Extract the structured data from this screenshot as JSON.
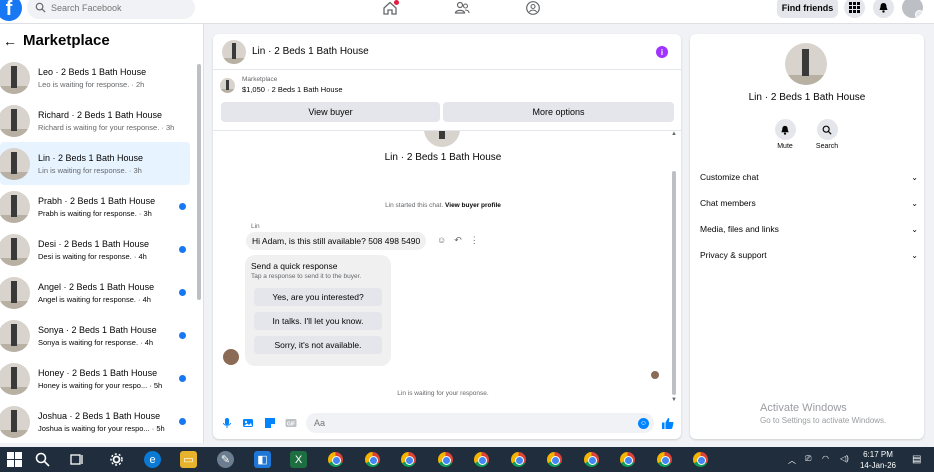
{
  "topbar": {
    "search_placeholder": "Search Facebook",
    "find_friends_label": "Find friends"
  },
  "left": {
    "back_arrow": "←",
    "title": "Marketplace",
    "threads": [
      {
        "title": "Leo · 2 Beds 1 Bath House",
        "sub": "Leo is waiting for response. · 2h",
        "unread": false,
        "active": false
      },
      {
        "title": "Richard · 2 Beds 1 Bath House",
        "sub": "Richard is waiting for your response. · 3h",
        "unread": false,
        "active": false
      },
      {
        "title": "Lin · 2 Beds 1 Bath House",
        "sub": "Lin is waiting for response. · 3h",
        "unread": false,
        "active": true
      },
      {
        "title": "Prabh · 2 Beds 1 Bath House",
        "sub": "Prabh is waiting for response. · 3h",
        "unread": true,
        "active": false
      },
      {
        "title": "Desi · 2 Beds 1 Bath House",
        "sub": "Desi is waiting for response. · 4h",
        "unread": true,
        "active": false
      },
      {
        "title": "Angel · 2 Beds 1 Bath House",
        "sub": "Angel is waiting for response. · 4h",
        "unread": true,
        "active": false
      },
      {
        "title": "Sonya · 2 Beds 1 Bath House",
        "sub": "Sonya is waiting for response. · 4h",
        "unread": true,
        "active": false
      },
      {
        "title": "Honey · 2 Beds 1 Bath House",
        "sub": "Honey is waiting for your respo... · 5h",
        "unread": true,
        "active": false
      },
      {
        "title": "Joshua · 2 Beds 1 Bath House",
        "sub": "Joshua is waiting for your respo... · 5h",
        "unread": true,
        "active": false
      }
    ]
  },
  "chat": {
    "header_title": "Lin · 2 Beds 1 Bath House",
    "listing_label": "Marketplace",
    "listing_price": "$1,050 · 2 Beds 1 Bath House",
    "view_buyer_label": "View buyer",
    "more_options_label": "More options",
    "conv_title": "Lin · 2 Beds 1 Bath House",
    "started_text": "Lin started this chat.",
    "view_profile_link": "View buyer profile",
    "sender_name": "Lin",
    "message": "Hi Adam, is this still available? 508 498 5490",
    "quick_title": "Send a quick response",
    "quick_sub": "Tap a response to send it to the buyer.",
    "quick_responses": [
      "Yes, are you interested?",
      "In talks. I'll let you know.",
      "Sorry, it's not available."
    ],
    "waiting_text": "Lin is waiting for your response.",
    "composer_placeholder": "Aa"
  },
  "right": {
    "title": "Lin · 2 Beds 1 Bath House",
    "mute_label": "Mute",
    "search_label": "Search",
    "rows": [
      "Customize chat",
      "Chat members",
      "Media, files and links",
      "Privacy & support"
    ]
  },
  "watermark": {
    "line1": "Activate Windows",
    "line2": "Go to Settings to activate Windows."
  },
  "taskbar": {
    "time": "6:17 PM",
    "date": "14-Jan-26"
  },
  "colors": {
    "brand_blue": "#1877f2",
    "info_purple": "#a033ff",
    "taskbar_bg": "#1f2d3c"
  }
}
